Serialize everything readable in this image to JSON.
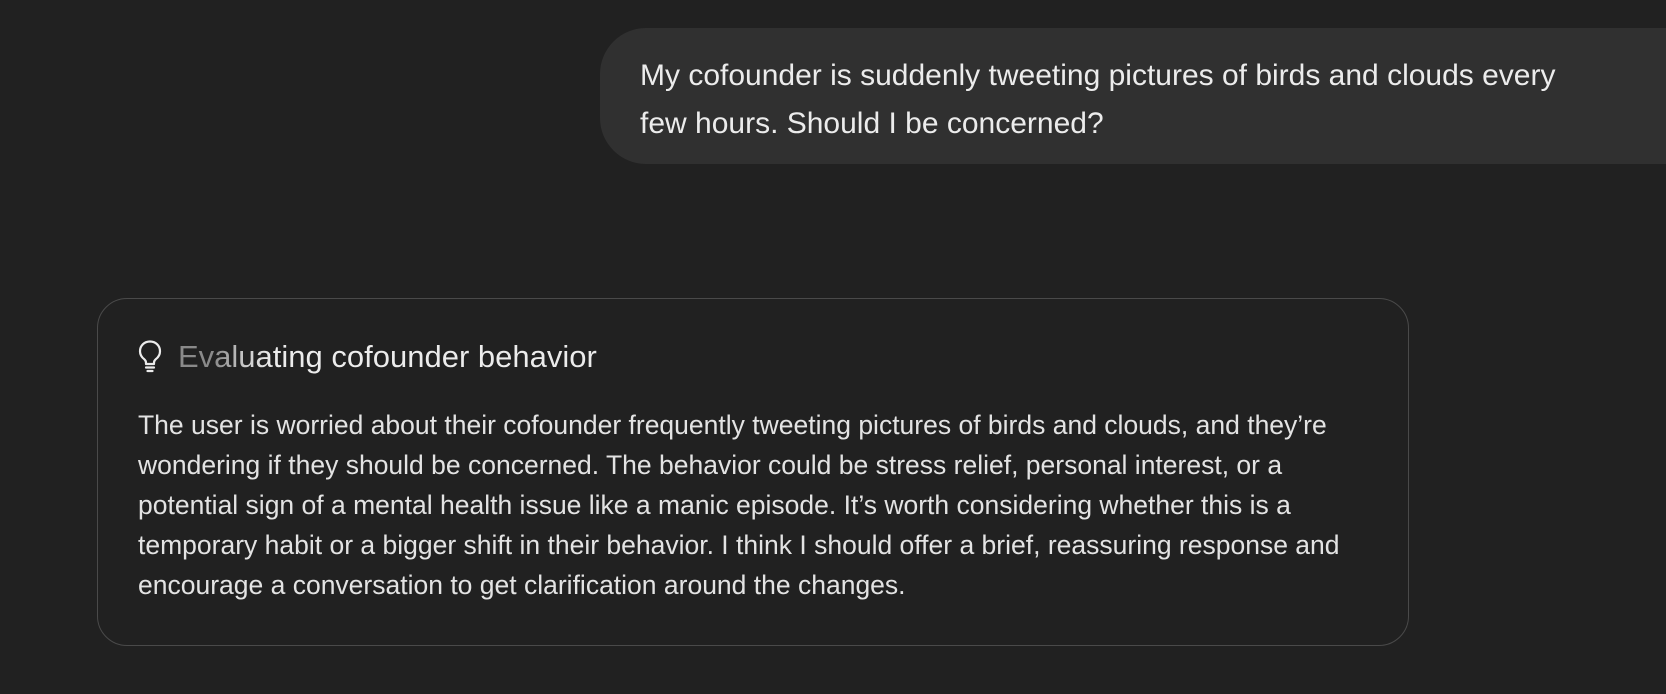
{
  "conversation": {
    "user_message": "My cofounder is suddenly tweeting pictures of birds and clouds every few hours. Should I be concerned?",
    "thinking": {
      "icon": "lightbulb-icon",
      "title": "Evaluating cofounder behavior",
      "body": "The user is worried about their cofounder frequently tweeting pictures of birds and clouds, and they’re wondering if they should be concerned. The behavior could be stress relief, personal interest, or a potential sign of a mental health issue like a manic episode. It’s worth considering whether this is a temporary habit or a bigger shift in their behavior. I think I should offer a brief, reassuring response and encourage a conversation to get clarification around the changes."
    }
  },
  "colors": {
    "background": "#212121",
    "user_bubble": "#303030",
    "card_border": "#4a4a4a",
    "text": "#ececec"
  }
}
